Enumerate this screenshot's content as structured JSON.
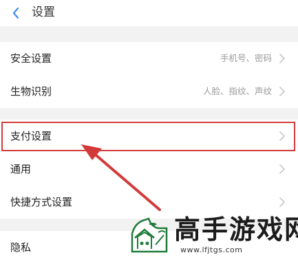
{
  "header": {
    "title": "设置",
    "back_icon": "chevron-left-icon"
  },
  "groups": [
    {
      "items": [
        {
          "label": "安全设置",
          "value": "手机号、密码"
        },
        {
          "label": "生物识别",
          "value": "人脸、指纹、声纹"
        }
      ]
    },
    {
      "items": [
        {
          "label": "支付设置",
          "value": "",
          "highlighted": true
        },
        {
          "label": "通用",
          "value": ""
        },
        {
          "label": "快捷方式设置",
          "value": ""
        }
      ]
    },
    {
      "items": [
        {
          "label": "隐私",
          "value": ""
        }
      ]
    }
  ],
  "annotation": {
    "color": "#d23a3a",
    "arrow_target": "支付设置"
  },
  "watermark": {
    "name": "高手游戏网",
    "url": "www.lfjtgs.com"
  },
  "colors": {
    "accent": "#3d8ef0",
    "background": "#f2f2f2",
    "annotation": "#d23a3a"
  }
}
